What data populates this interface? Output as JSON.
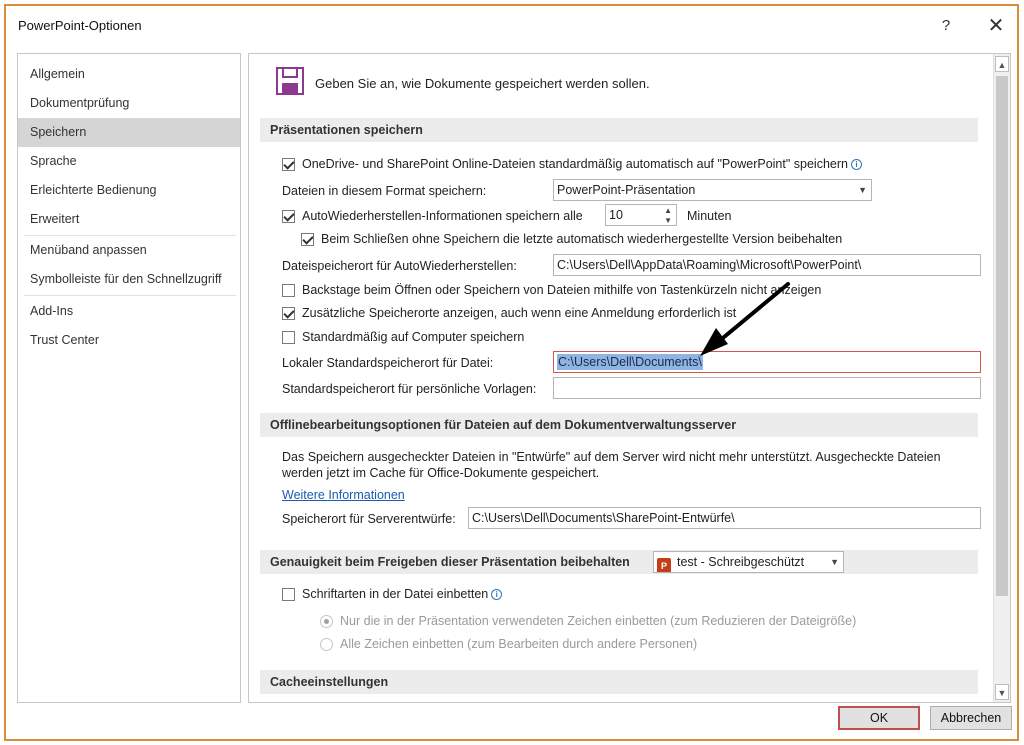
{
  "window": {
    "title": "PowerPoint-Optionen",
    "help_label": "?",
    "close_label": "✕"
  },
  "nav": {
    "items": [
      {
        "label": "Allgemein"
      },
      {
        "label": "Dokumentprüfung"
      },
      {
        "label": "Speichern"
      },
      {
        "label": "Sprache"
      },
      {
        "label": "Erleichterte Bedienung"
      },
      {
        "label": "Erweitert"
      },
      {
        "label": "Menüband anpassen"
      },
      {
        "label": "Symbolleiste für den Schnellzugriff"
      },
      {
        "label": "Add-Ins"
      },
      {
        "label": "Trust Center"
      }
    ],
    "selected": "Speichern"
  },
  "main": {
    "heading": "Geben Sie an, wie Dokumente gespeichert werden sollen.",
    "save_presentations": {
      "title": "Präsentationen speichern",
      "onedrive_autosave": {
        "label": "OneDrive- und SharePoint Online-Dateien standardmäßig automatisch auf \"PowerPoint\" speichern",
        "checked": true
      },
      "format_label": "Dateien in diesem Format speichern:",
      "format_value": "PowerPoint-Präsentation",
      "autorecover": {
        "label": "AutoWiederherstellen-Informationen speichern alle",
        "checked": true,
        "minutes": "10",
        "minutes_label": "Minuten"
      },
      "keep_last_version": {
        "label": "Beim Schließen ohne Speichern die letzte automatisch wiederhergestellte Version beibehalten",
        "checked": true
      },
      "autorecover_location_label": "Dateispeicherort für AutoWiederherstellen:",
      "autorecover_location": "C:\\Users\\Dell\\AppData\\Roaming\\Microsoft\\PowerPoint\\",
      "backstage": {
        "label": "Backstage beim Öffnen oder Speichern von Dateien mithilfe von Tastenkürzeln nicht anzeigen",
        "checked": false
      },
      "additional_locations": {
        "label": "Zusätzliche Speicherorte anzeigen, auch wenn eine Anmeldung erforderlich ist",
        "checked": true
      },
      "save_to_computer": {
        "label": "Standardmäßig auf Computer speichern",
        "checked": false
      },
      "local_default_label": "Lokaler Standardspeicherort für Datei:",
      "local_default_value": "C:\\Users\\Dell\\Documents\\",
      "templates_label": "Standardspeicherort für persönliche Vorlagen:",
      "templates_value": ""
    },
    "offline": {
      "title": "Offlinebearbeitungsoptionen für Dateien auf dem Dokumentverwaltungsserver",
      "desc_line1": "Das Speichern ausgecheckter Dateien in \"Entwürfe\" auf dem Server wird nicht mehr unterstützt. Ausgecheckte Dateien",
      "desc_line2": "werden jetzt im Cache für Office-Dokumente gespeichert.",
      "more_info": "Weitere Informationen",
      "drafts_label": "Speicherort für Serverentwürfe:",
      "drafts_value": "C:\\Users\\Dell\\Documents\\SharePoint-Entwürfe\\"
    },
    "fidelity": {
      "title": "Genauigkeit beim Freigeben dieser Präsentation beibehalten",
      "file_value": "test  -  Schreibgeschützt",
      "embed_fonts": {
        "label": "Schriftarten in der Datei einbetten",
        "checked": false
      },
      "embed_used": "Nur die in der Präsentation verwendeten Zeichen einbetten (zum Reduzieren der Dateigröße)",
      "embed_all": "Alle Zeichen einbetten (zum Bearbeiten durch andere Personen)"
    },
    "cache": {
      "title": "Cacheeinstellungen"
    }
  },
  "footer": {
    "ok_label": "OK",
    "cancel_label": "Abbrechen"
  },
  "colors": {
    "window_border": "#d98c3a",
    "selection_highlight": "#8eb4e3",
    "ok_border": "#c0504d",
    "link": "#1a5db0"
  },
  "icons": [
    "save-icon",
    "info-icon",
    "powerpoint-file-icon",
    "chevron-down-icon",
    "spinner-icon",
    "close-icon",
    "help-icon"
  ]
}
